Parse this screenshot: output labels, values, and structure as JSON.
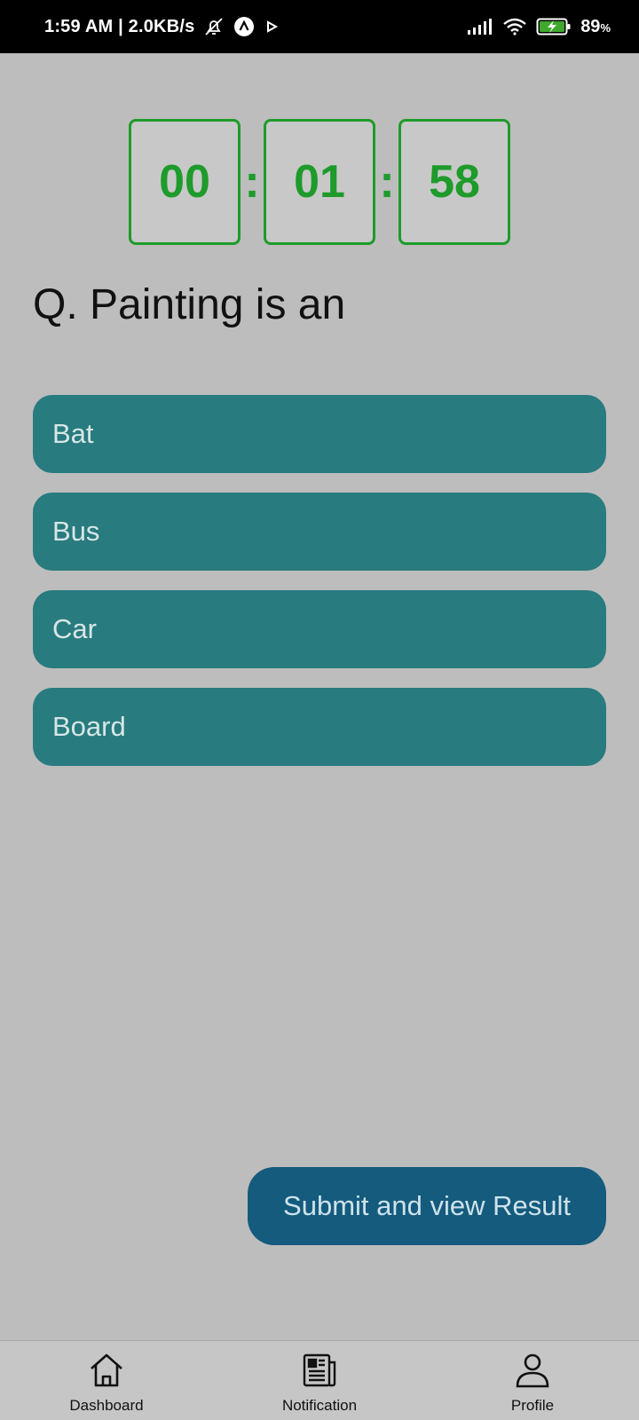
{
  "status_bar": {
    "time_and_speed": "1:59 AM | 2.0KB/s",
    "icons": [
      "bell-off-icon",
      "app-a-icon",
      "play-icon",
      "signal-icon",
      "wifi-icon",
      "battery-charging-icon"
    ],
    "battery_percent": "89",
    "battery_percent_sign": "%"
  },
  "timer": {
    "hours": "00",
    "minutes": "01",
    "seconds": "58",
    "separator": ":",
    "color": "#1e9b2b"
  },
  "question": {
    "text": "Q. Painting is an"
  },
  "options": [
    {
      "label": "Bat"
    },
    {
      "label": "Bus"
    },
    {
      "label": "Car"
    },
    {
      "label": "Board"
    }
  ],
  "submit": {
    "label": "Submit and view Result"
  },
  "bottom_nav": {
    "items": [
      {
        "label": "Dashboard",
        "icon": "home-icon"
      },
      {
        "label": "Notification",
        "icon": "newspaper-icon"
      },
      {
        "label": "Profile",
        "icon": "person-icon"
      }
    ]
  },
  "colors": {
    "option_bg": "#287b7e",
    "submit_bg": "#145b7d",
    "page_bg": "#bdbdbd"
  }
}
